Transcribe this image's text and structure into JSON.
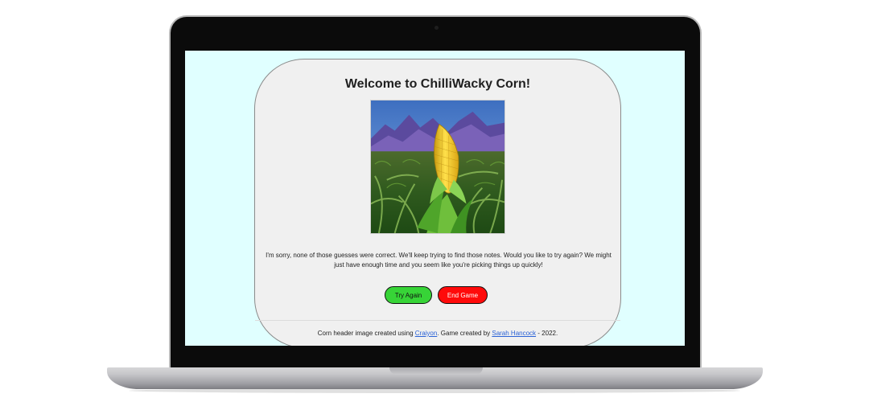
{
  "game": {
    "title": "Welcome to ChilliWacky Corn!",
    "image_alt": "Corn header image",
    "message": "I'm sorry, none of those guesses were correct. We'll keep trying to find those notes. Would you like to try again? We might just have enough time and you seem like you're picking things up quickly!",
    "buttons": {
      "try_again": "Try Again",
      "end_game": "End Game"
    },
    "footer": {
      "text_1": "Corn header image created using ",
      "link_1": "Craiyon",
      "text_2": ". Game created by ",
      "link_2": "Sarah Hancock",
      "text_3": " - 2022."
    }
  },
  "colors": {
    "page_background": "#e0ffff",
    "card_background": "#f0f0f0",
    "try_again_button": "#37d437",
    "end_game_button": "#ff0a0a",
    "link": "#2a62d6"
  }
}
